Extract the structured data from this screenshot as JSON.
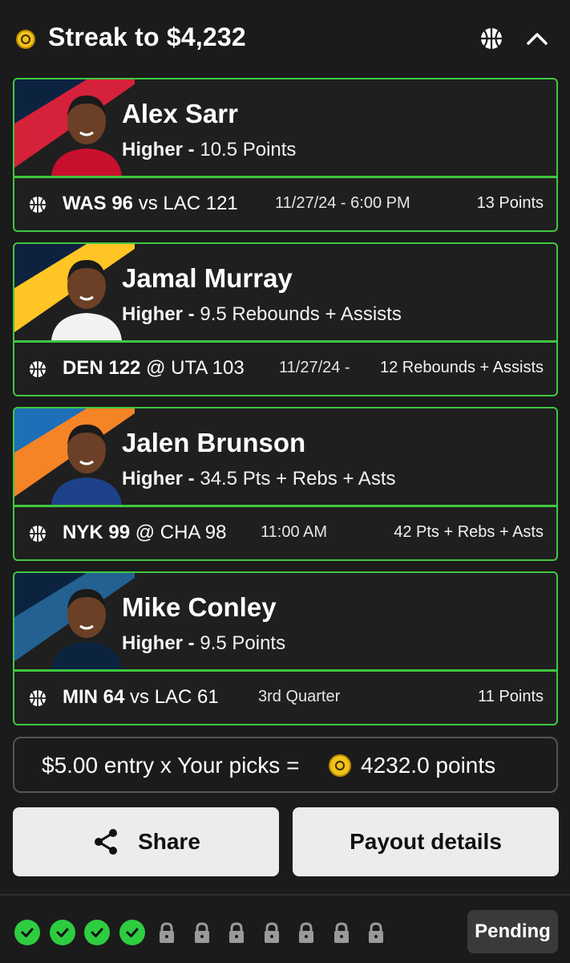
{
  "header": {
    "title": "Streak to $4,232",
    "coin_icon": "coin-icon",
    "sport_icon": "basketball-icon",
    "collapse_icon": "chevron-up-icon"
  },
  "colors": {
    "accent_green": "#3fc83f",
    "background": "#1b1b1b",
    "card_background": "#1f1f1f",
    "button_background": "#ececec"
  },
  "picks": [
    {
      "player": "Alex Sarr",
      "direction": "Higher",
      "line": "10.5 Points",
      "score_team": "WAS 96",
      "score_sep": "vs",
      "score_opp": "LAC 121",
      "time": "11/27/24 - 6:00 PM",
      "result": "13 Points",
      "stripe_colors": [
        "#d6213a",
        "#0c2340"
      ]
    },
    {
      "player": "Jamal Murray",
      "direction": "Higher",
      "line": "9.5 Rebounds + Assists",
      "score_team": "DEN 122",
      "score_sep": "@",
      "score_opp": "UTA 103",
      "time": "11/27/24 -",
      "result": "12 Rebounds + Assists",
      "stripe_colors": [
        "#fec524",
        "#0e2240"
      ]
    },
    {
      "player": "Jalen Brunson",
      "direction": "Higher",
      "line": "34.5 Pts + Rebs + Asts",
      "score_team": "NYK 99",
      "score_sep": "@",
      "score_opp": "CHA 98",
      "time": "11:00 AM",
      "result": "42 Pts + Rebs + Asts",
      "stripe_colors": [
        "#f58426",
        "#1d6fb8"
      ]
    },
    {
      "player": "Mike Conley",
      "direction": "Higher",
      "line": "9.5 Points",
      "score_team": "MIN 64",
      "score_sep": "vs",
      "score_opp": "LAC 61",
      "time": "3rd Quarter",
      "result": "11 Points",
      "stripe_colors": [
        "#236192",
        "#0c2340"
      ]
    }
  ],
  "entry": {
    "text": "$5.00 entry x Your picks =",
    "points": "4232.0 points"
  },
  "buttons": {
    "share": "Share",
    "payout": "Payout details"
  },
  "progress": {
    "completed": 4,
    "locked": 7,
    "status": "Pending"
  }
}
